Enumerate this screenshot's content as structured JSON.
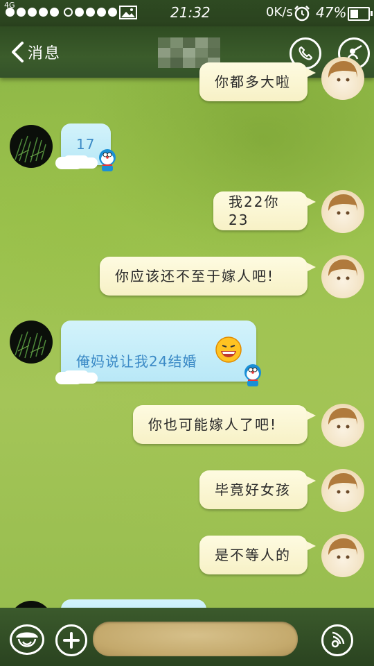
{
  "status_bar": {
    "network": "4G",
    "time": "21:32",
    "speed": "0K/s",
    "battery": "47%",
    "battery_level": 0.47
  },
  "header": {
    "back_label": "消息"
  },
  "messages": [
    {
      "side": "me",
      "text": "你都多大啦"
    },
    {
      "side": "peer",
      "text": "17"
    },
    {
      "side": "me",
      "text": "我22你23"
    },
    {
      "side": "me",
      "text": "你应该还不至于嫁人吧!"
    },
    {
      "side": "peer",
      "text": "俺妈说让我24结婚"
    },
    {
      "side": "me",
      "text": "你也可能嫁人了吧!"
    },
    {
      "side": "me",
      "text": "毕竟好女孩"
    },
    {
      "side": "me",
      "text": "是不等人的"
    }
  ],
  "icons": {
    "call": "phone-icon",
    "profile": "profile-icon",
    "emoji": "emoji-icon",
    "add": "plus-icon",
    "voice": "voice-icon"
  }
}
